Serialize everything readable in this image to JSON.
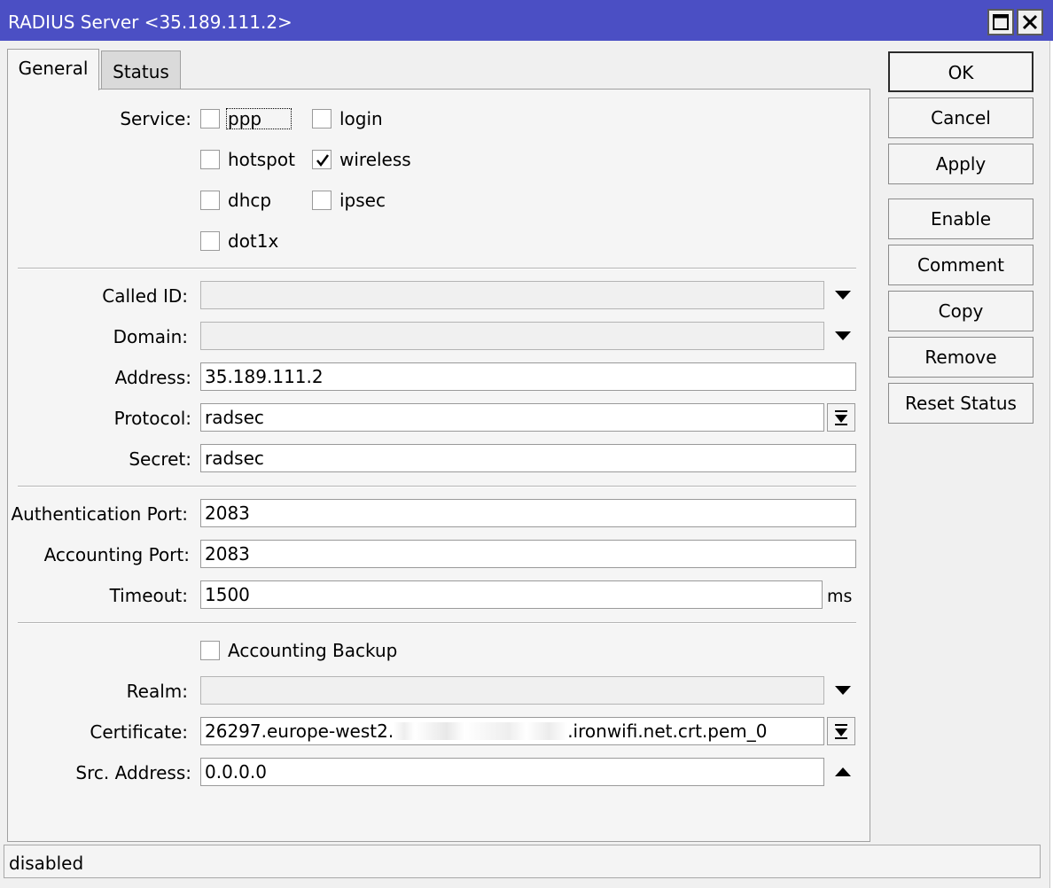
{
  "window": {
    "title": "RADIUS Server <35.189.111.2>"
  },
  "tabs": [
    {
      "label": "General",
      "active": true
    },
    {
      "label": "Status",
      "active": false
    }
  ],
  "service": {
    "label": "Service:",
    "options": [
      {
        "label": "ppp",
        "checked": false
      },
      {
        "label": "login",
        "checked": false
      },
      {
        "label": "hotspot",
        "checked": false
      },
      {
        "label": "wireless",
        "checked": true
      },
      {
        "label": "dhcp",
        "checked": false
      },
      {
        "label": "ipsec",
        "checked": false
      },
      {
        "label": "dot1x",
        "checked": false
      }
    ]
  },
  "fields": {
    "called_id": {
      "label": "Called ID:",
      "value": ""
    },
    "domain": {
      "label": "Domain:",
      "value": ""
    },
    "address": {
      "label": "Address:",
      "value": "35.189.111.2"
    },
    "protocol": {
      "label": "Protocol:",
      "value": "radsec"
    },
    "secret": {
      "label": "Secret:",
      "value": "radsec"
    },
    "auth_port": {
      "label": "Authentication Port:",
      "value": "2083"
    },
    "acct_port": {
      "label": "Accounting Port:",
      "value": "2083"
    },
    "timeout": {
      "label": "Timeout:",
      "value": "1500",
      "unit": "ms"
    },
    "accounting_backup": {
      "label": "Accounting Backup",
      "checked": false
    },
    "realm": {
      "label": "Realm:",
      "value": ""
    },
    "certificate": {
      "label": "Certificate:",
      "value_start": "26297.europe-west2.",
      "value_end": ".ironwifi.net.crt.pem_0"
    },
    "src_address": {
      "label": "Src. Address:",
      "value": "0.0.0.0"
    }
  },
  "buttons": {
    "ok": "OK",
    "cancel": "Cancel",
    "apply": "Apply",
    "enable": "Enable",
    "comment": "Comment",
    "copy": "Copy",
    "remove": "Remove",
    "reset_status": "Reset Status"
  },
  "status_bar": {
    "text": "disabled"
  },
  "icons": {
    "maximize": "maximize-icon",
    "close": "close-icon",
    "dropdown": "triangle-down-icon",
    "dropdown_list": "dropdown-list-icon",
    "collapse": "triangle-up-icon",
    "check": "check-icon"
  },
  "colors": {
    "titlebar": "#4b4fc4",
    "panel": "#f5f5f5",
    "window": "#f0f0f0"
  }
}
